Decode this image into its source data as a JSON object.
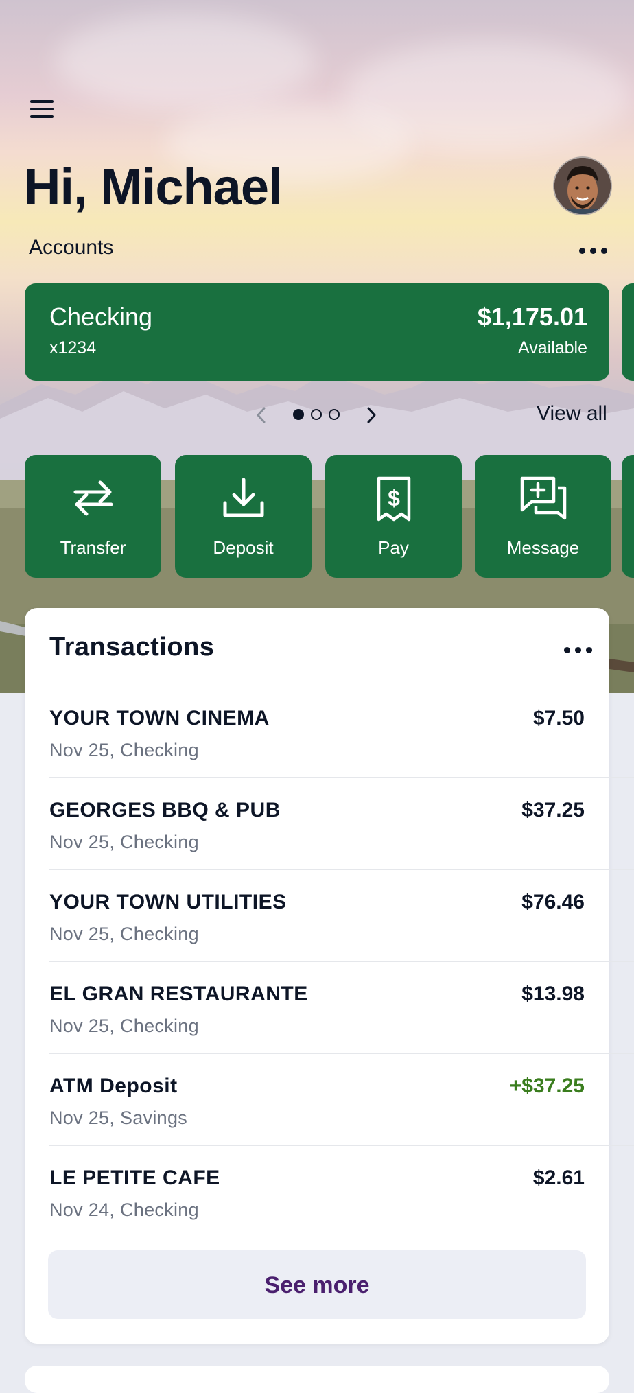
{
  "header": {
    "greeting": "Hi, Michael",
    "menu_icon": "hamburger-menu-icon",
    "avatar_icon": "user-avatar"
  },
  "accounts": {
    "label": "Accounts",
    "more_icon": "more-horizontal-icon",
    "cards": [
      {
        "name": "Checking",
        "number": "x1234",
        "balance": "$1,175.01",
        "balance_label": "Available"
      }
    ],
    "pager": {
      "pages": 3,
      "current": 1
    },
    "view_all": "View all"
  },
  "actions": [
    {
      "label": "Transfer",
      "icon": "transfer-arrows-icon"
    },
    {
      "label": "Deposit",
      "icon": "download-tray-icon"
    },
    {
      "label": "Pay",
      "icon": "receipt-dollar-icon"
    },
    {
      "label": "Message",
      "icon": "message-add-icon"
    }
  ],
  "transactions": {
    "title": "Transactions",
    "items": [
      {
        "merchant": "YOUR TOWN CINEMA",
        "meta": "Nov 25, Checking",
        "amount": "$7.50",
        "type": "debit"
      },
      {
        "merchant": "GEORGES BBQ & PUB",
        "meta": "Nov 25, Checking",
        "amount": "$37.25",
        "type": "debit"
      },
      {
        "merchant": "YOUR TOWN UTILITIES",
        "meta": "Nov 25, Checking",
        "amount": "$76.46",
        "type": "debit"
      },
      {
        "merchant": "EL GRAN RESTAURANTE",
        "meta": "Nov 25, Checking",
        "amount": "$13.98",
        "type": "debit"
      },
      {
        "merchant": "ATM Deposit",
        "meta": "Nov 25, Savings",
        "amount": "+$37.25",
        "type": "credit"
      },
      {
        "merchant": "LE PETITE CAFE",
        "meta": "Nov 24, Checking",
        "amount": "$2.61",
        "type": "debit"
      }
    ],
    "see_more": "See more"
  },
  "colors": {
    "brand_green": "#19703f",
    "credit_green": "#3a7d1e",
    "see_more_text": "#4a1f6e",
    "text_dark": "#0d1526"
  }
}
